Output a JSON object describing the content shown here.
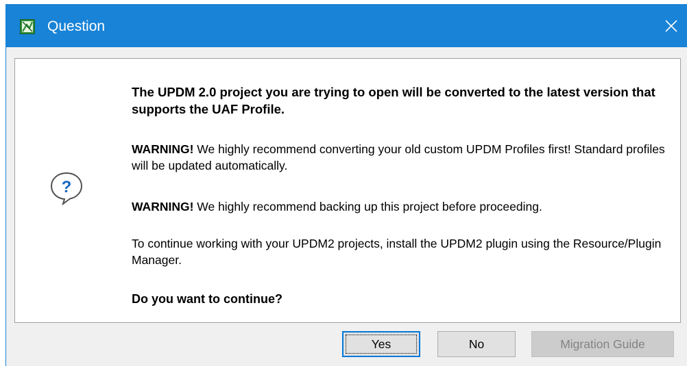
{
  "window": {
    "title": "Question",
    "app_icon": "magicdraw-app-icon",
    "close_icon": "close-icon",
    "titlebar_color": "#1883d7"
  },
  "message": {
    "icon": "question-balloon-icon",
    "headline": "The UPDM 2.0 project you are trying to open will be converted to the latest version that supports the UAF Profile.",
    "warning1_prefix": "WARNING!",
    "warning1_text": " We highly recommend converting your old custom UPDM Profiles first! Standard profiles will be updated automatically.",
    "warning2_prefix": "WARNING!",
    "warning2_text": " We highly recommend backing up this project before proceeding.",
    "info": "To continue working with your UPDM2 projects, install the UPDM2 plugin using the Resource/Plugin Manager.",
    "prompt": "Do you want to continue?"
  },
  "buttons": {
    "yes": "Yes",
    "no": "No",
    "migration_guide": "Migration Guide"
  }
}
